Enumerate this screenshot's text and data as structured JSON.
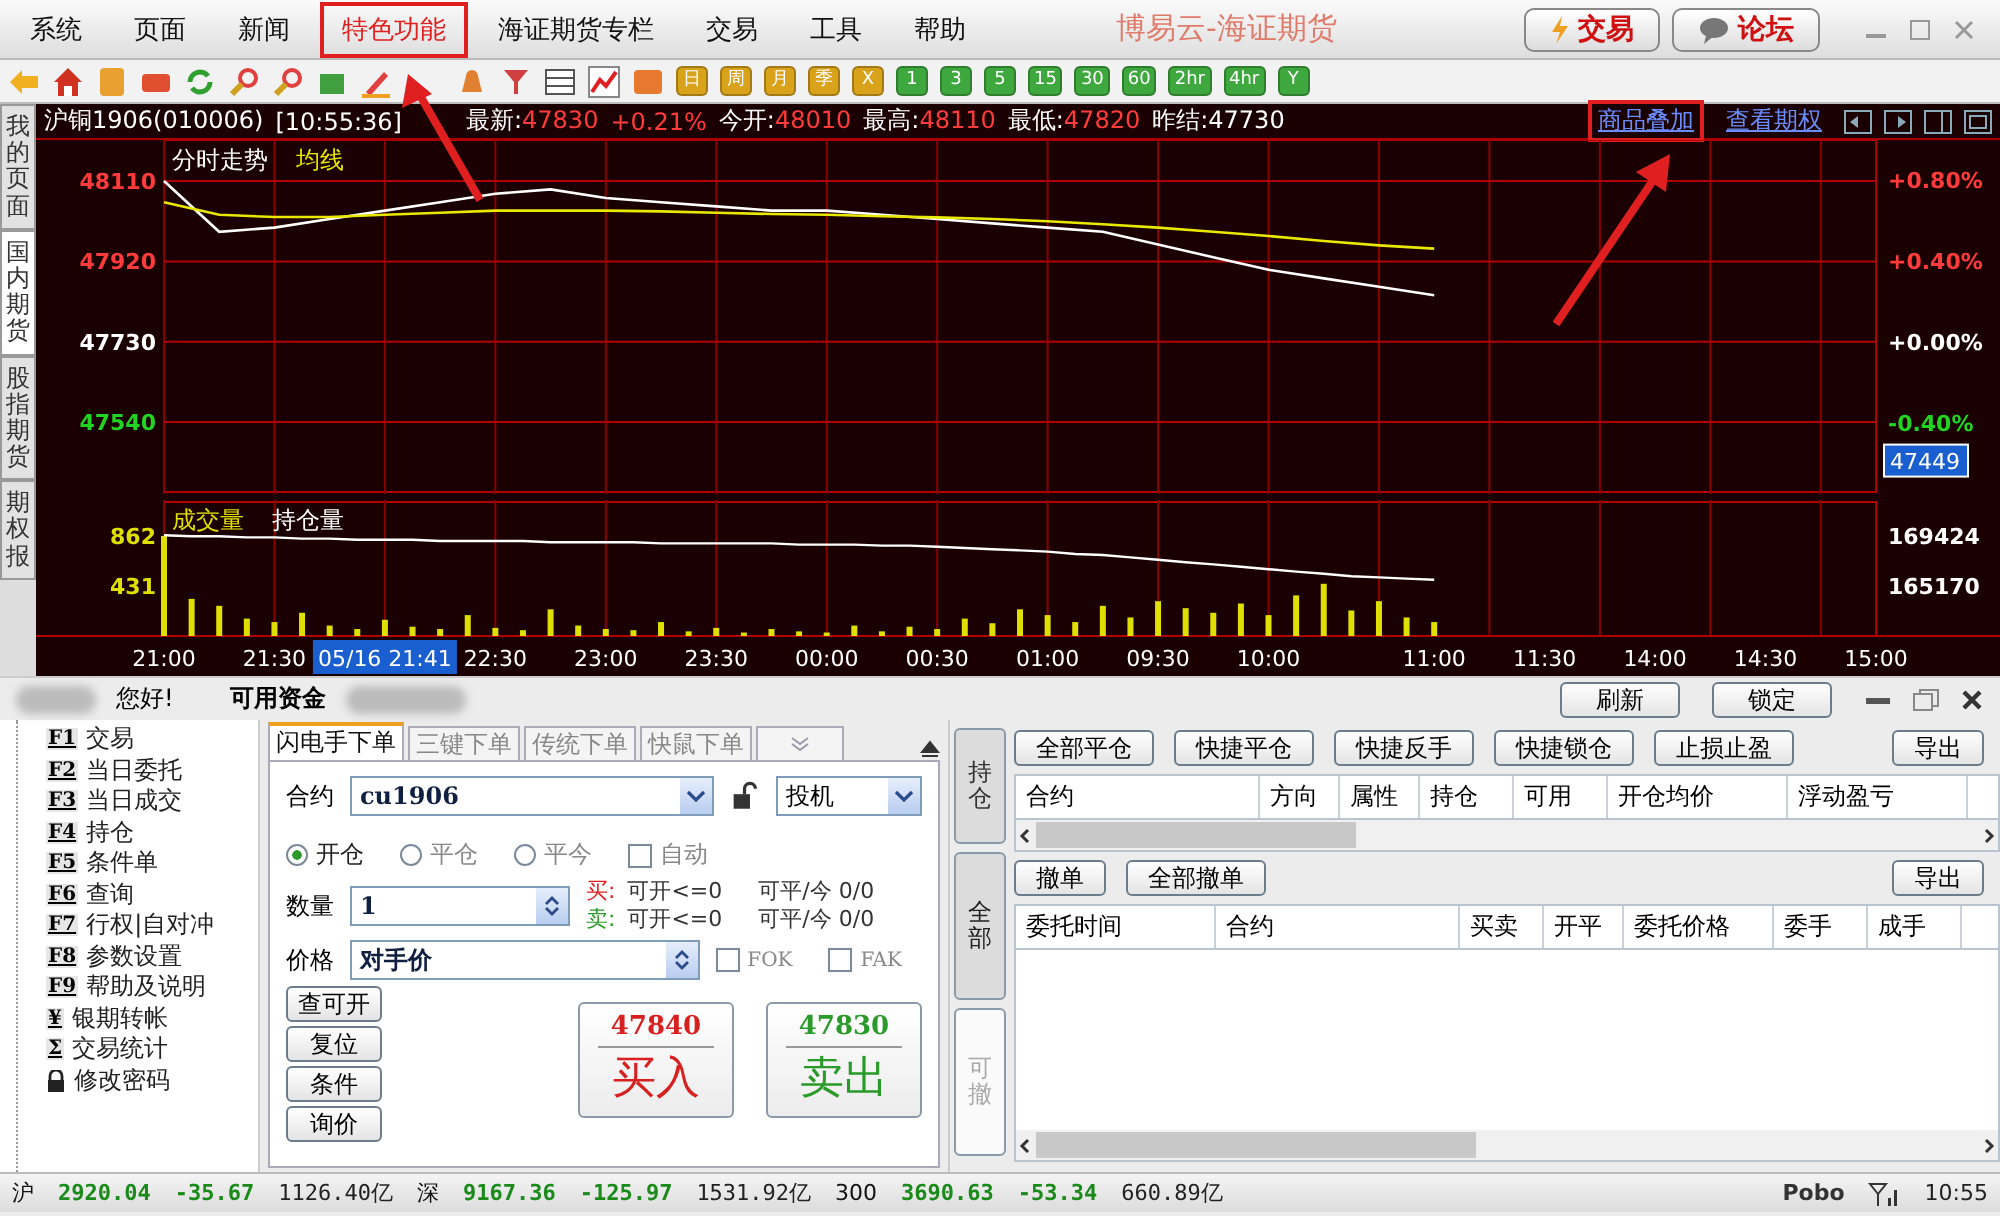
{
  "menu": {
    "items": [
      {
        "label": "系统",
        "highlighted": false
      },
      {
        "label": "页面",
        "highlighted": false
      },
      {
        "label": "新闻",
        "highlighted": false
      },
      {
        "label": "特色功能",
        "highlighted": true
      },
      {
        "label": "海证期货专栏",
        "highlighted": false
      },
      {
        "label": "交易",
        "highlighted": false
      },
      {
        "label": "工具",
        "highlighted": false
      },
      {
        "label": "帮助",
        "highlighted": false
      }
    ],
    "app_title": "博易云-海证期货",
    "buttons": [
      {
        "label": "交易",
        "kind": "trade"
      },
      {
        "label": "论坛",
        "kind": "forum"
      }
    ]
  },
  "periods": [
    {
      "label": "日",
      "color": "#d9a21b"
    },
    {
      "label": "周",
      "color": "#d9a21b"
    },
    {
      "label": "月",
      "color": "#d9a21b"
    },
    {
      "label": "季",
      "color": "#d9a21b"
    },
    {
      "label": "X",
      "color": "#d9a21b"
    },
    {
      "label": "1",
      "color": "#3ea83e"
    },
    {
      "label": "3",
      "color": "#3ea83e"
    },
    {
      "label": "5",
      "color": "#3ea83e"
    },
    {
      "label": "15",
      "color": "#3ea83e"
    },
    {
      "label": "30",
      "color": "#3ea83e"
    },
    {
      "label": "60",
      "color": "#3ea83e"
    },
    {
      "label": "2hr",
      "color": "#3ea83e"
    },
    {
      "label": "4hr",
      "color": "#3ea83e"
    },
    {
      "label": "Y",
      "color": "#3ea83e"
    }
  ],
  "side_tabs": [
    {
      "label": "我的页面",
      "selected": false
    },
    {
      "label": "国内期货",
      "selected": true
    },
    {
      "label": "股指期货",
      "selected": false
    },
    {
      "label": "期权报",
      "selected": false
    }
  ],
  "quote_bar": {
    "symbol": "沪铜1906(010006)",
    "time": "[10:55:36]",
    "fields": [
      {
        "label": "最新:",
        "value": "47830",
        "color": "#ff3b3b"
      },
      {
        "value": "+0.21%",
        "color": "#ff3b3b"
      },
      {
        "label": "今开:",
        "value": "48010",
        "color": "#ff3b3b"
      },
      {
        "label": "最高:",
        "value": "48110",
        "color": "#ff3b3b"
      },
      {
        "label": "最低:",
        "value": "47820",
        "color": "#ff3b3b"
      },
      {
        "label": "昨结:",
        "value": "47730",
        "color": "#ffffff"
      }
    ],
    "links": [
      {
        "label": "商品叠加",
        "highlighted": true
      },
      {
        "label": "查看期权",
        "highlighted": false
      }
    ]
  },
  "price_chart": {
    "current_price": "47449",
    "chart_data": {
      "type": "line",
      "categories": [
        null,
        null,
        null,
        null,
        null,
        null,
        null,
        null,
        null,
        null,
        null,
        null,
        null,
        null,
        null,
        null,
        null,
        null,
        null,
        null,
        null,
        null,
        null,
        null,
        null,
        null,
        null,
        null,
        null,
        null,
        null,
        null
      ],
      "ylim": [
        47370,
        48207
      ],
      "y2lim": [
        -0.754,
        0.999
      ],
      "grid": true,
      "yticks": [
        {
          "value": 48110,
          "label": "48110"
        },
        {
          "value": 47920,
          "label": "47920"
        },
        {
          "value": 47730,
          "label": "47730"
        },
        {
          "value": 47540,
          "label": "47540"
        }
      ],
      "y2ticks": [
        {
          "value": 0.8,
          "label": "+0.80%"
        },
        {
          "value": 0.4,
          "label": "+0.40%"
        },
        {
          "value": 0,
          "label": "+0.00%"
        },
        {
          "value": -0.4,
          "label": "-0.40%"
        }
      ],
      "series": [
        {
          "name": "分时走势",
          "color": "#ffffff",
          "values": [
            48110,
            47990,
            48000,
            48020,
            48040,
            48060,
            48080,
            48090,
            48070,
            48060,
            48050,
            48040,
            48040,
            48030,
            48020,
            48010,
            48000,
            47990,
            47960,
            47930,
            47900,
            47880,
            47860,
            47840,
            null,
            null,
            null,
            null,
            null,
            null,
            null,
            null
          ]
        },
        {
          "name": "均线",
          "color": "#e8e800",
          "values": [
            48060,
            48030,
            48025,
            48025,
            48030,
            48035,
            48040,
            48040,
            48040,
            48038,
            48035,
            48032,
            48030,
            48027,
            48024,
            48020,
            48015,
            48008,
            48000,
            47990,
            47980,
            47968,
            47958,
            47950,
            null,
            null,
            null,
            null,
            null,
            null,
            null,
            null
          ]
        }
      ]
    }
  },
  "volume_chart": {
    "cursor_label": "05/16 21:41",
    "chart_data": {
      "type": "bar",
      "categories": [
        "21:00",
        null,
        null,
        null,
        "21:30",
        null,
        null,
        null,
        null,
        null,
        null,
        null,
        "22:30",
        null,
        null,
        null,
        "23:00",
        null,
        null,
        null,
        "23:30",
        null,
        null,
        null,
        "00:00",
        null,
        null,
        null,
        "00:30",
        null,
        null,
        null,
        "01:00",
        null,
        null,
        null,
        "09:30",
        null,
        null,
        null,
        "10:00",
        null,
        null,
        null,
        null,
        null,
        "11:00",
        null,
        null,
        null,
        "11:30",
        null,
        null,
        null,
        "14:00",
        null,
        null,
        null,
        "14:30",
        null,
        null,
        null,
        "15:00"
      ],
      "ylim": [
        0,
        1172
      ],
      "y2lim": [
        160916,
        172487
      ],
      "grid": true,
      "yticks": [
        {
          "value": 862,
          "label": "862"
        },
        {
          "value": 431,
          "label": "431"
        }
      ],
      "y2ticks": [
        {
          "value": 169424,
          "label": "169424"
        },
        {
          "value": 165170,
          "label": "165170"
        }
      ],
      "series": [
        {
          "name": "成交量",
          "color": "#e0e000",
          "values": [
            862,
            320,
            260,
            150,
            120,
            200,
            90,
            60,
            140,
            80,
            60,
            180,
            70,
            50,
            230,
            90,
            60,
            50,
            120,
            40,
            70,
            30,
            60,
            40,
            30,
            90,
            40,
            80,
            60,
            150,
            110,
            230,
            180,
            120,
            260,
            160,
            300,
            240,
            200,
            280,
            180,
            350,
            450,
            220,
            300,
            160,
            120,
            null,
            null,
            null,
            null,
            null,
            null,
            null,
            null,
            null,
            null,
            null,
            null,
            null,
            null,
            null,
            null
          ]
        },
        {
          "name": "持仓量",
          "color": "#ffffff",
          "type": "line",
          "axis": "y2",
          "values": [
            169500,
            169400,
            169400,
            169300,
            169300,
            169200,
            169200,
            169100,
            169100,
            169100,
            169000,
            169000,
            169000,
            169000,
            168900,
            168900,
            168900,
            168900,
            168800,
            168800,
            168800,
            168800,
            168800,
            168700,
            168700,
            168700,
            168600,
            168600,
            168500,
            168400,
            168300,
            168200,
            168100,
            167900,
            167800,
            167600,
            167400,
            167200,
            167000,
            166800,
            166600,
            166400,
            166200,
            166000,
            165900,
            165800,
            165700,
            null,
            null,
            null,
            null,
            null,
            null,
            null,
            null,
            null,
            null,
            null,
            null,
            null,
            null,
            null,
            null
          ]
        }
      ]
    }
  },
  "trade_header": {
    "greeting": "您好!",
    "funds_label": "可用资金",
    "buttons": [
      "刷新",
      "锁定"
    ]
  },
  "function_tree": [
    {
      "kind": "key",
      "key": "F1",
      "label": "交易"
    },
    {
      "kind": "key",
      "key": "F2",
      "label": "当日委托"
    },
    {
      "kind": "key",
      "key": "F3",
      "label": "当日成交"
    },
    {
      "kind": "key",
      "key": "F4",
      "label": "持仓"
    },
    {
      "kind": "key",
      "key": "F5",
      "label": "条件单"
    },
    {
      "kind": "key",
      "key": "F6",
      "label": "查询"
    },
    {
      "kind": "key",
      "key": "F7",
      "label": "行权|自对冲"
    },
    {
      "kind": "key",
      "key": "F8",
      "label": "参数设置"
    },
    {
      "kind": "key",
      "key": "F9",
      "label": "帮助及说明"
    },
    {
      "kind": "key",
      "key": "¥",
      "label": "银期转帐"
    },
    {
      "kind": "key",
      "key": "Σ",
      "label": "交易统计"
    },
    {
      "kind": "lock",
      "label": "修改密码"
    }
  ],
  "order_tabs": [
    {
      "label": "闪电手下单",
      "selected": true
    },
    {
      "label": "三键下单",
      "selected": false
    },
    {
      "label": "传统下单",
      "selected": false
    },
    {
      "label": "快鼠下单",
      "selected": false
    }
  ],
  "order_form": {
    "contract_label": "合约",
    "contract": "cu1906",
    "hedge": "投机",
    "offsets": [
      {
        "label": "开仓",
        "selected": true
      },
      {
        "label": "平仓",
        "selected": false
      },
      {
        "label": "平今",
        "selected": false
      }
    ],
    "auto": {
      "label": "自动",
      "checked": false
    },
    "qty_label": "数量",
    "qty": "1",
    "info": [
      {
        "label": "买:",
        "color": "#e02020",
        "open": "可开<=0",
        "close": "可平/今 0/0"
      },
      {
        "label": "卖:",
        "color": "#2a9a2a",
        "open": "可开<=0",
        "close": "可平/今 0/0"
      }
    ],
    "price_label": "价格",
    "price": "对手价",
    "flags": [
      {
        "label": "FOK",
        "checked": false
      },
      {
        "label": "FAK",
        "checked": false
      }
    ],
    "small_buttons": [
      "查可开",
      "复位",
      "条件",
      "询价"
    ],
    "big_buttons": [
      {
        "price": "47840",
        "label": "买入",
        "color": "#d82020"
      },
      {
        "price": "47830",
        "label": "卖出",
        "color": "#2a9a2a"
      }
    ]
  },
  "positions": {
    "tab": "持仓",
    "buttons": [
      "全部平仓",
      "快捷平仓",
      "快捷反手",
      "快捷锁仓",
      "止损止盈"
    ],
    "export": "导出",
    "columns": [
      "合约",
      "方向",
      "属性",
      "持仓",
      "可用",
      "开仓均价",
      "浮动盈亏"
    ]
  },
  "orders": {
    "tabs": [
      {
        "label": "全部",
        "selected": true
      },
      {
        "label": "可撤",
        "selected": false
      }
    ],
    "buttons": [
      "撤单",
      "全部撤单"
    ],
    "export": "导出",
    "columns": [
      "委托时间",
      "合约",
      "买卖",
      "开平",
      "委托价格",
      "委手",
      "成手"
    ]
  },
  "status_bar": {
    "markets": [
      {
        "name": "沪",
        "price": "2920.04",
        "change": "-35.67",
        "amount": "1126.40亿"
      },
      {
        "name": "深",
        "price": "9167.36",
        "change": "-125.97",
        "amount": "1531.92亿"
      },
      {
        "name": "300",
        "price": "3690.63",
        "change": "-53.34",
        "amount": "660.89亿"
      }
    ],
    "logo": "Pobo",
    "time": "10:55"
  }
}
